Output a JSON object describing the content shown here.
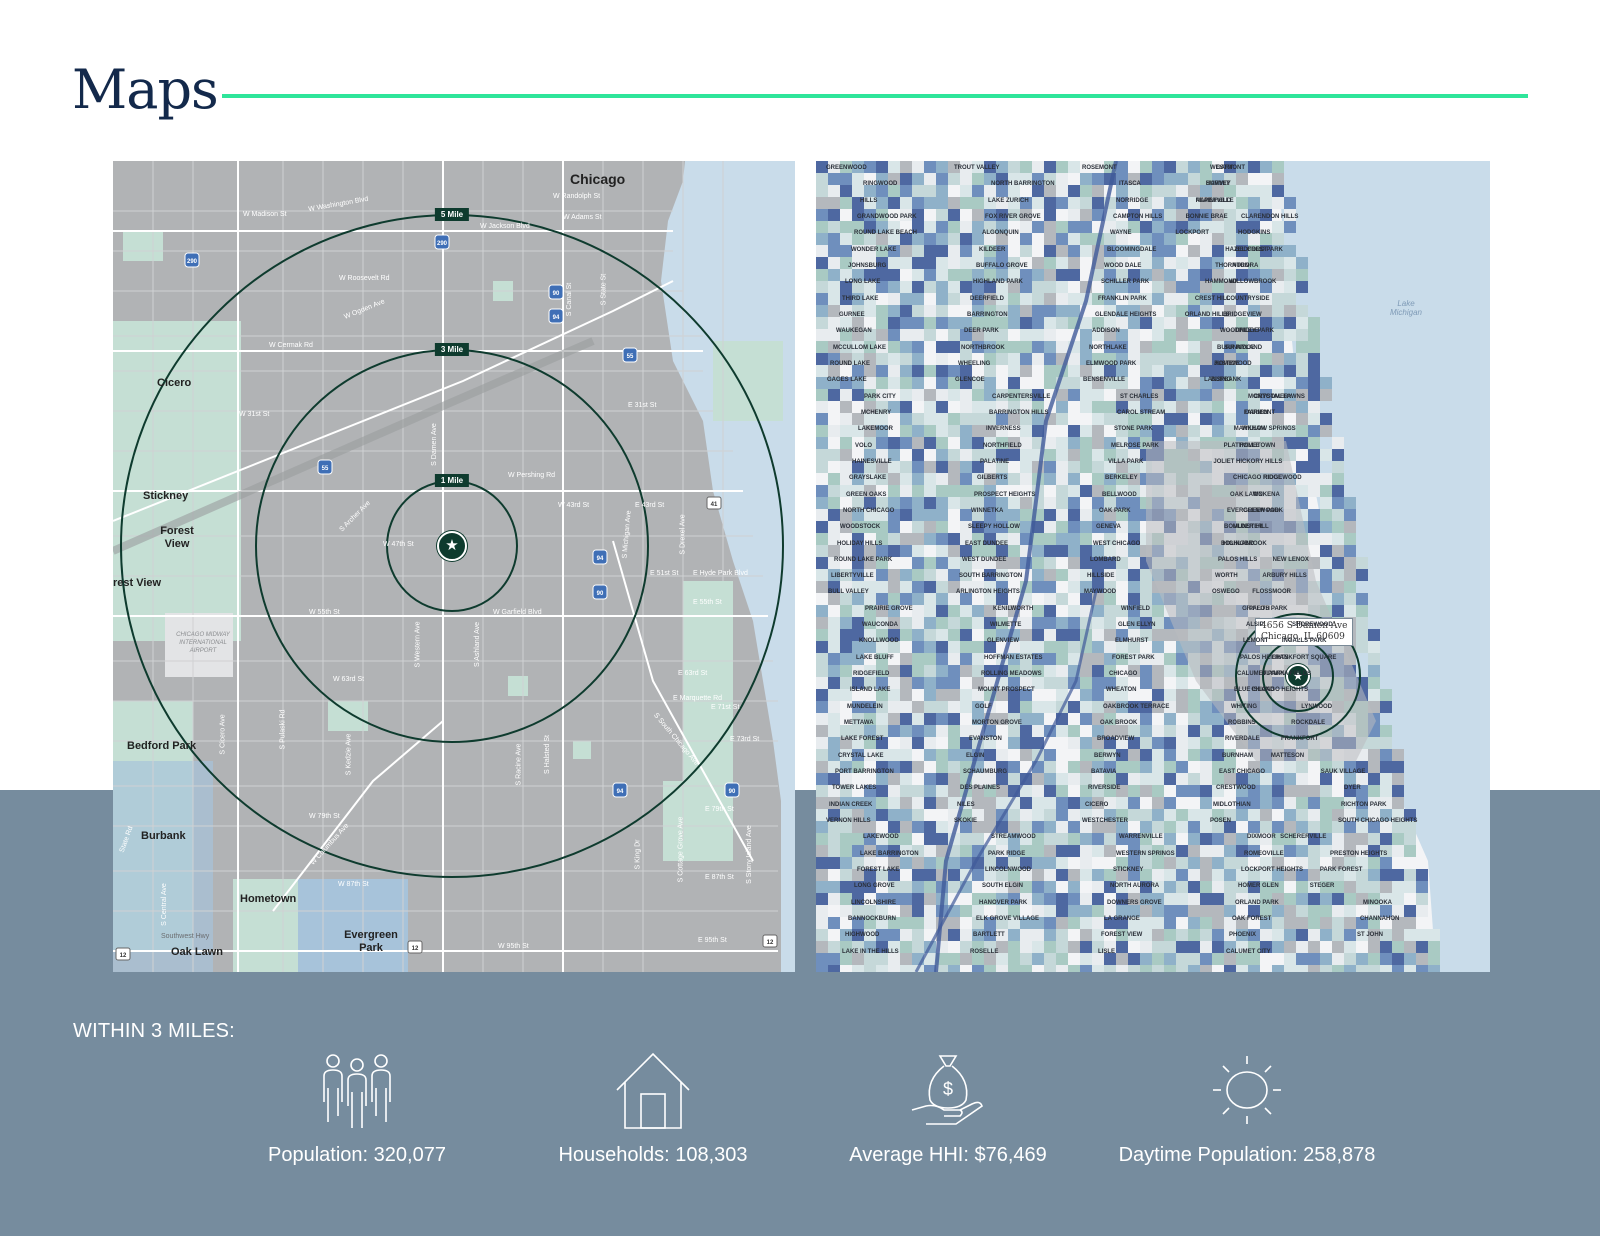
{
  "page": {
    "title": "Maps"
  },
  "left_map": {
    "rings": [
      "1 Mile",
      "3 Mile",
      "5 Mile"
    ],
    "city_labels": [
      "Chicago",
      "Cicero",
      "Stickney",
      "Forest View",
      "rest View",
      "Bedford Park",
      "Burbank",
      "Hometown",
      "Evergreen Park",
      "Oak Lawn"
    ],
    "street_labels": [
      "W Madison St",
      "W Washington Blvd",
      "W Randolph St",
      "W Adams St",
      "W Jackson Blvd",
      "W Roosevelt Rd",
      "W Ogden Ave",
      "W Cermak Rd",
      "W 31st St",
      "E 31st St",
      "W Pershing Rd",
      "W 43rd St",
      "E 43rd St",
      "W 47th St",
      "E 51st St",
      "E Hyde Park Blvd",
      "W 55th St",
      "W Garfield Blvd",
      "E 55th St",
      "W 63rd St",
      "E 63rd St",
      "E Marquette Rd",
      "E 71st St",
      "E 73rd St",
      "W 79th St",
      "E 79th St",
      "W 87th St",
      "E 87th St",
      "W 95th St",
      "E 95th St",
      "S Archer Ave",
      "S Damen Ave",
      "S Western Ave",
      "S Ashland Ave",
      "S Halsted St",
      "S Racine Ave",
      "S Pulaski Rd",
      "S Kedzie Ave",
      "S Cicero Ave",
      "S Central Ave",
      "S Cottage Grove Ave",
      "S King Dr",
      "S Stony Island Ave",
      "S South Chicago Ave",
      "W Columbus Ave",
      "Southwest Hwy",
      "State Rd",
      "S Michigan Ave",
      "S Drexel Ave",
      "S State St",
      "S Canal St"
    ],
    "airport_label": "CHICAGO MIDWAY INTERNATIONAL AIRPORT",
    "highway_shields": [
      "290",
      "290",
      "90",
      "94",
      "55",
      "55",
      "94",
      "90",
      "94",
      "90",
      "41",
      "12",
      "12",
      "12"
    ]
  },
  "right_map": {
    "address": {
      "line1": "4656 S Damen Ave",
      "line2": "Chicago, IL 60609"
    },
    "lake_label": "Lake Michigan",
    "place_labels": [
      "GREENWOOD",
      "RINGWOOD",
      "HILLS",
      "GRANDWOOD PARK",
      "ROUND LAKE BEACH",
      "WONDER LAKE",
      "JOHNSBURG",
      "LONG LAKE",
      "THIRD LAKE",
      "GURNEE",
      "WAUKEGAN",
      "MCCULLOM LAKE",
      "ROUND LAKE",
      "GAGES LAKE",
      "PARK CITY",
      "MCHENRY",
      "LAKEMOOR",
      "VOLO",
      "HAINESVILLE",
      "GRAYSLAKE",
      "GREEN OAKS",
      "NORTH CHICAGO",
      "WOODSTOCK",
      "HOLIDAY HILLS",
      "ROUND LAKE PARK",
      "LIBERTYVILLE",
      "BULL VALLEY",
      "PRAIRIE GROVE",
      "WAUCONDA",
      "KNOLLWOOD",
      "LAKE BLUFF",
      "RIDGEFIELD",
      "ISLAND LAKE",
      "MUNDELEIN",
      "METTAWA",
      "LAKE FOREST",
      "CRYSTAL LAKE",
      "PORT BARRINGTON",
      "TOWER LAKES",
      "INDIAN CREEK",
      "VERNON HILLS",
      "LAKEWOOD",
      "LAKE BARRINGTON",
      "FOREST LAKE",
      "LONG GROVE",
      "LINCOLNSHIRE",
      "BANNOCKBURN",
      "HIGHWOOD",
      "LAKE IN THE HILLS",
      "TROUT VALLEY",
      "NORTH BARRINGTON",
      "LAKE ZURICH",
      "FOX RIVER GROVE",
      "ALGONQUIN",
      "KILDEER",
      "BUFFALO GROVE",
      "HIGHLAND PARK",
      "DEERFIELD",
      "BARRINGTON",
      "DEER PARK",
      "NORTHBROOK",
      "WHEELING",
      "GLENCOE",
      "CARPENTERSVILLE",
      "BARRINGTON HILLS",
      "INVERNESS",
      "NORTHFIELD",
      "PALATINE",
      "GILBERTS",
      "PROSPECT HEIGHTS",
      "WINNETKA",
      "SLEEPY HOLLOW",
      "EAST DUNDEE",
      "WEST DUNDEE",
      "SOUTH BARRINGTON",
      "ARLINGTON HEIGHTS",
      "KENILWORTH",
      "WILMETTE",
      "GLENVIEW",
      "HOFFMAN ESTATES",
      "ROLLING MEADOWS",
      "MOUNT PROSPECT",
      "GOLF",
      "MORTON GROVE",
      "EVANSTON",
      "ELGIN",
      "SCHAUMBURG",
      "DES PLAINES",
      "NILES",
      "SKOKIE",
      "STREAMWOOD",
      "PARK RIDGE",
      "LINCOLNWOOD",
      "SOUTH ELGIN",
      "HANOVER PARK",
      "ELK GROVE VILLAGE",
      "BARTLETT",
      "ROSELLE",
      "ROSEMONT",
      "ITASCA",
      "NORRIDGE",
      "CAMPTON HILLS",
      "WAYNE",
      "BLOOMINGDALE",
      "WOOD DALE",
      "SCHILLER PARK",
      "FRANKLIN PARK",
      "GLENDALE HEIGHTS",
      "ADDISON",
      "NORTHLAKE",
      "ELMWOOD PARK",
      "BENSENVILLE",
      "ST CHARLES",
      "CAROL STREAM",
      "STONE PARK",
      "MELROSE PARK",
      "VILLA PARK",
      "BERKELEY",
      "BELLWOOD",
      "OAK PARK",
      "GENEVA",
      "WEST CHICAGO",
      "LOMBARD",
      "HILLSIDE",
      "MAYWOOD",
      "WINFIELD",
      "GLEN ELLYN",
      "ELMHURST",
      "FOREST PARK",
      "CHICAGO",
      "WHEATON",
      "OAKBROOK TERRACE",
      "OAK BROOK",
      "BROADVIEW",
      "BERWYN",
      "BATAVIA",
      "RIVERSIDE",
      "CICERO",
      "WESTCHESTER",
      "WARRENVILLE",
      "WESTERN SPRINGS",
      "STICKNEY",
      "NORTH AURORA",
      "DOWNERS GROVE",
      "LA GRANGE",
      "FOREST VIEW",
      "LISLE",
      "WESTMONT",
      "SUMMIT",
      "NAPERVILLE",
      "CLARENDON HILLS",
      "HODGKINS",
      "BEDFORD PARK",
      "AURORA",
      "WILLOWBROOK",
      "COUNTRYSIDE",
      "BRIDGEVIEW",
      "WOODRIDGE",
      "BURR RIDGE",
      "JUSTICE",
      "BURBANK",
      "MONTGOMERY",
      "DARIEN",
      "WILLOW SPRINGS",
      "HOMETOWN",
      "HICKORY HILLS",
      "CHICAGO RIDGE",
      "OAK LAWN",
      "EVERGREEN PARK",
      "BOULDER HILL",
      "BOLINGBROOK",
      "PALOS HILLS",
      "WORTH",
      "OSWEGO",
      "PALOS PARK",
      "ALSIP",
      "LEMONT",
      "PALOS HEIGHTS",
      "CALUMET PARK",
      "BLUE ISLAND",
      "WHITING",
      "ROBBINS",
      "RIVERDALE",
      "BURNHAM",
      "EAST CHICAGO",
      "CRESTWOOD",
      "MIDLOTHIAN",
      "POSEN",
      "DIXMOOR",
      "ROMEOVILLE",
      "LOCKPORT HEIGHTS",
      "HOMER GLEN",
      "ORLAND PARK",
      "OAK FOREST",
      "PHOENIX",
      "CALUMET CITY",
      "GARY",
      "HARVEY",
      "PLAINFIELD",
      "BONNIE BRAE",
      "LOCKPORT",
      "HAZEL CREST",
      "THORNTON",
      "HAMMOND",
      "CREST HILL",
      "ORLAND HILLS",
      "TINLEY PARK",
      "SUNNYLAND",
      "HOMEWOOD",
      "LANSING",
      "CRYSTAL LAWNS",
      "FAIRMONT",
      "MARKHAM",
      "PLATTVILLE",
      "JOLIET",
      "RIDGEWOOD",
      "MOKENA",
      "GLENWOOD",
      "MUNSTER",
      "HIGHLAND",
      "NEW LENOX",
      "ARBURY HILLS",
      "FLOSSMOOR",
      "GRIFFITH",
      "SHOREWOOD",
      "INGALLS PARK",
      "FRANKFORT SQUARE",
      "OLYMPIA FIELDS",
      "CHICAGO HEIGHTS",
      "LYNWOOD",
      "ROCKDALE",
      "FRANKFORT",
      "MATTESON",
      "SAUK VILLAGE",
      "DYER",
      "RICHTON PARK",
      "SOUTH CHICAGO HEIGHTS",
      "SCHERERVILLE",
      "PRESTON HEIGHTS",
      "PARK FOREST",
      "STEGER",
      "MINOOKA",
      "CHANNAHON",
      "ST JOHN"
    ]
  },
  "stats": {
    "heading": "WITHIN 3 MILES:",
    "items": [
      {
        "icon": "people-icon",
        "label": "Population: 320,077"
      },
      {
        "icon": "house-icon",
        "label": "Households: 108,303"
      },
      {
        "icon": "money-bag-hand-icon",
        "label": "Average HHI: $76,469"
      },
      {
        "icon": "sun-icon",
        "label": "Daytime Population: 258,878"
      }
    ]
  },
  "colors": {
    "title": "#13294b",
    "accent_rule": "#2ee59a",
    "band": "#768c9e",
    "ring": "#0e3b2e",
    "map_gray": "#b1b3b5",
    "water": "#c9dcea",
    "park_green": "#c5dfd4"
  }
}
